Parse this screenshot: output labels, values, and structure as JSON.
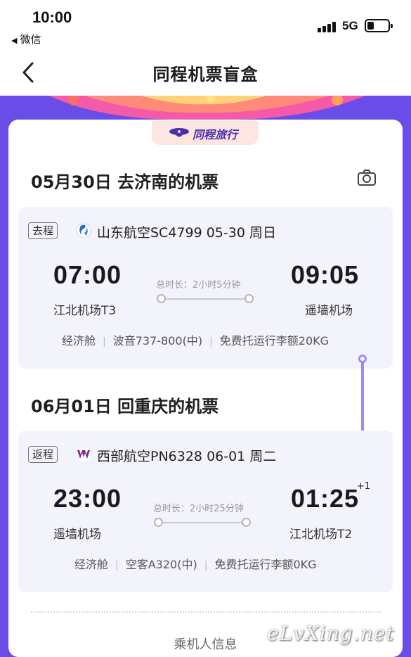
{
  "status": {
    "time": "10:00",
    "back_app": "微信",
    "network": "5G"
  },
  "nav": {
    "title": "同程机票盲盒"
  },
  "brand": {
    "name": "同程旅行"
  },
  "outbound": {
    "section_title": "05月30日 去济南的机票",
    "tag": "去程",
    "airline_flight": "山东航空SC4799 05-30 周日",
    "depart_time": "07:00",
    "arrive_time": "09:05",
    "depart_airport": "江北机场T3",
    "arrive_airport": "遥墙机场",
    "duration": "总时长：2小时5分钟",
    "cabin": "经济舱",
    "aircraft": "波音737-800(中)",
    "baggage": "免费托运行李额20KG"
  },
  "return": {
    "section_title": "06月01日 回重庆的机票",
    "tag": "返程",
    "airline_flight": "西部航空PN6328 06-01 周二",
    "depart_time": "23:00",
    "arrive_time": "01:25",
    "plus_day": "+1",
    "depart_airport": "遥墙机场",
    "arrive_airport": "江北机场T2",
    "duration": "总时长：2小时25分钟",
    "cabin": "经济舱",
    "aircraft": "空客A320(中)",
    "baggage": "免费托运行李额0KG"
  },
  "passenger": {
    "title": "乘机人信息"
  },
  "watermark": "eLvXing.net",
  "colors": {
    "purple_bg": "#6a4de8",
    "card_bg": "#ffffff",
    "flight_box_bg": "#f3f3fb",
    "brand_purple": "#4a2fb0",
    "connector": "#9d8cf0"
  },
  "icons": {
    "back": "chevron-left-icon",
    "camera": "camera-icon",
    "shandong_airline": "shandong-airlines-logo-icon",
    "west_air": "west-air-logo-icon"
  }
}
